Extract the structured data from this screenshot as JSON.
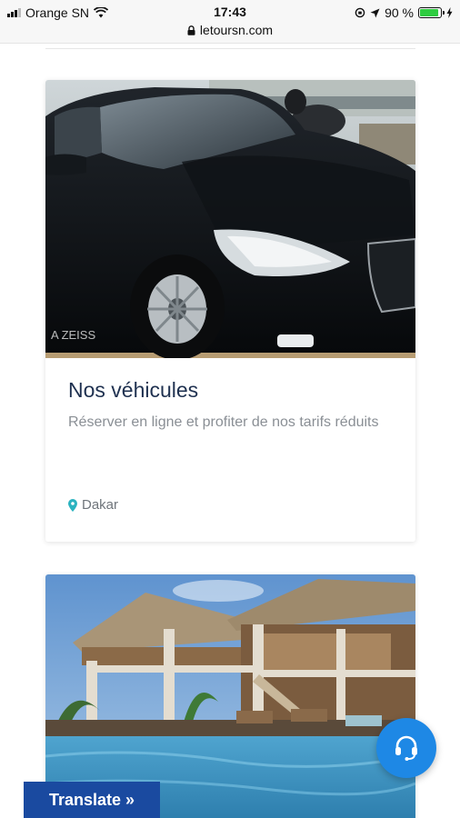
{
  "status_bar": {
    "carrier": "Orange SN",
    "time": "17:43",
    "battery": "90 %",
    "battery_level": 0.9
  },
  "browser": {
    "url": "letoursn.com"
  },
  "cards": [
    {
      "title": "Nos véhicules",
      "description": "Réserver en ligne et profiter de nos tarifs réduits",
      "location": "Dakar",
      "image_watermark": "A  ZEISS"
    },
    {
      "title": "",
      "description": "",
      "location": ""
    }
  ],
  "support_button": {
    "icon": "headset-icon"
  },
  "translate_button": {
    "label": "Translate »"
  },
  "colors": {
    "title": "#1f3150",
    "accent": "#1e88e5",
    "translate_bg": "#1a4aa0",
    "location_pin": "#2bb3c0"
  }
}
